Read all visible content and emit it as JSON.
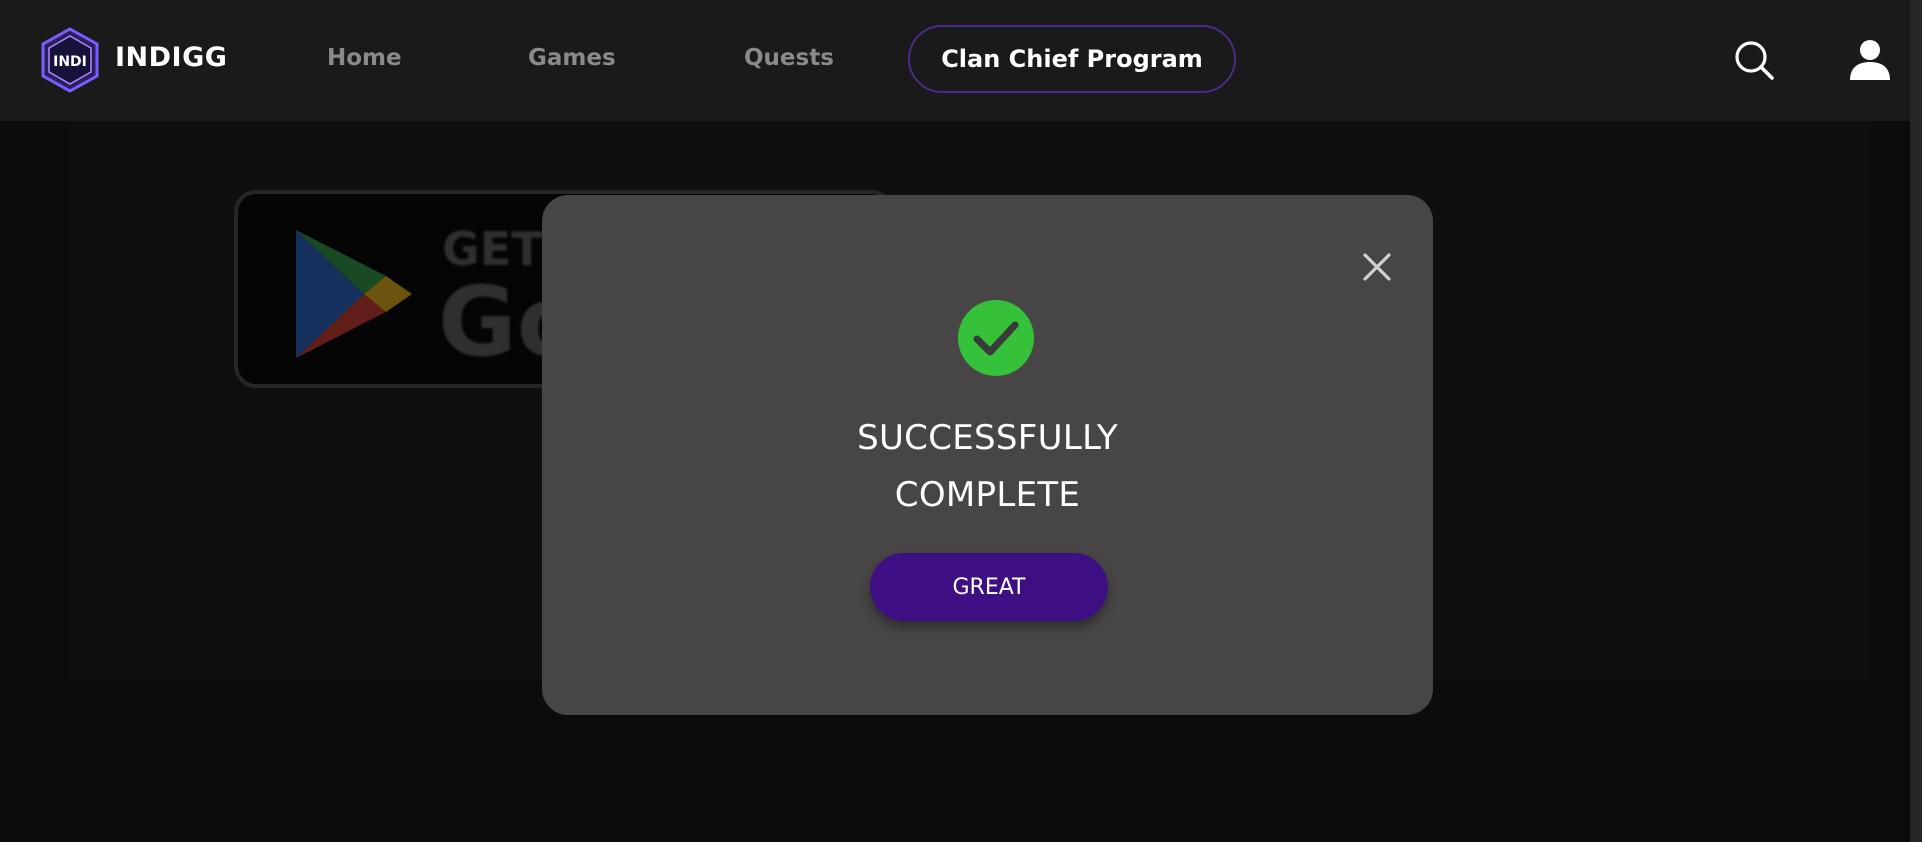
{
  "header": {
    "brand": "INDIGG",
    "logo_text": "INDI",
    "nav": {
      "home": "Home",
      "games": "Games",
      "quests": "Quests",
      "clan_chief": "Clan Chief Program"
    },
    "icons": {
      "search": "search-icon",
      "user": "user-icon"
    }
  },
  "background": {
    "store_badge": {
      "small_text": "GET I",
      "big_text": "Go"
    }
  },
  "modal": {
    "title_line1": "SUCCESSFULLY",
    "title_line2": "COMPLETE",
    "button_label": "GREAT",
    "icons": {
      "close": "close-icon",
      "success": "check-circle-icon"
    }
  },
  "colors": {
    "header_bg": "#1a1a1a",
    "page_bg": "#0c0c0c",
    "modal_bg": "#474545",
    "accent_purple": "#3d0f82",
    "success_green": "#35c13a",
    "nav_active_border": "#4a2a8a"
  }
}
